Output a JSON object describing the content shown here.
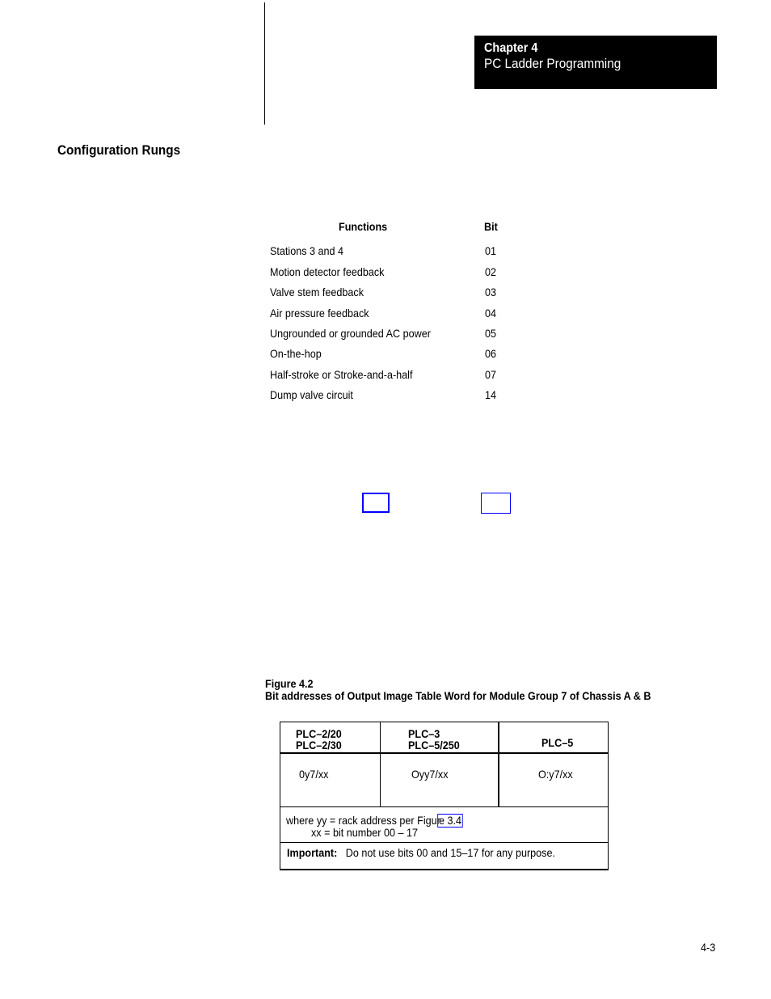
{
  "header": {
    "chapter_number": "Chapter 4",
    "chapter_title": "PC Ladder Programming"
  },
  "section": {
    "title": "Configuration Rungs"
  },
  "functions_table": {
    "headers": {
      "function": "Functions",
      "bit": "Bit"
    },
    "rows": [
      {
        "function": "Stations 3 and 4",
        "bit": "01"
      },
      {
        "function": "Motion detector feedback",
        "bit": "02"
      },
      {
        "function": "Valve stem feedback",
        "bit": "03"
      },
      {
        "function": "Air pressure feedback",
        "bit": "04"
      },
      {
        "function": "Ungrounded or grounded AC power",
        "bit": "05"
      },
      {
        "function": "On-the-hop",
        "bit": "06"
      },
      {
        "function": "Half-stroke or Stroke-and-a-half",
        "bit": "07"
      },
      {
        "function": "Dump valve circuit",
        "bit": "14"
      }
    ]
  },
  "link_boxes": {
    "colors": {
      "link": "#0000ff"
    }
  },
  "figure": {
    "number": "Figure 4.2",
    "caption": "Bit addresses of Output Image Table Word for Module Group 7 of Chassis A & B",
    "columns": [
      {
        "header_line1": "PLC–2/20",
        "header_line2": "PLC–2/30",
        "value": "0y7/xx"
      },
      {
        "header_line1": "PLC–3",
        "header_line2": "PLC–5/250",
        "value": "Oyy7/xx"
      },
      {
        "header_line1": "",
        "header_line2": "PLC–5",
        "value": "O:y7/xx"
      }
    ],
    "where_line1_prefix": "where yy  =  rack address per Figur",
    "where_line1_link": "e 3.4",
    "where_line2": "xx  =  bit number 00 – 17",
    "important_label": "Important:",
    "important_text": "Do not use bits 00 and 15–17 for any purpose."
  },
  "footer": {
    "page_number": "4-3"
  }
}
